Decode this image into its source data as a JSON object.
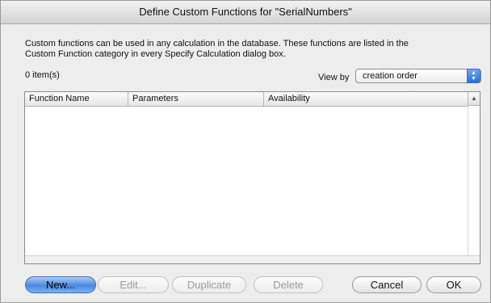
{
  "dialog": {
    "title": "Define Custom Functions for \"SerialNumbers\"",
    "description_line1": "Custom functions can be used in any calculation in the database. These functions are listed in the",
    "description_line2": "Custom Function category in every Specify Calculation dialog box.",
    "item_count": "0 item(s)",
    "view_by_label": "View by",
    "view_by_value": "creation order"
  },
  "table": {
    "columns": [
      "Function Name",
      "Parameters",
      "Availability"
    ],
    "rows": []
  },
  "buttons": {
    "new": "New...",
    "edit": "Edit...",
    "duplicate": "Duplicate",
    "delete": "Delete",
    "cancel": "Cancel",
    "ok": "OK"
  },
  "icons": {
    "select_arrows": "up-down-arrows-icon",
    "scroll_up": "scroll-up-arrow-icon"
  },
  "colors": {
    "default_button": "#4b88e0",
    "select_arrow_bg": "#2d6fd6"
  }
}
